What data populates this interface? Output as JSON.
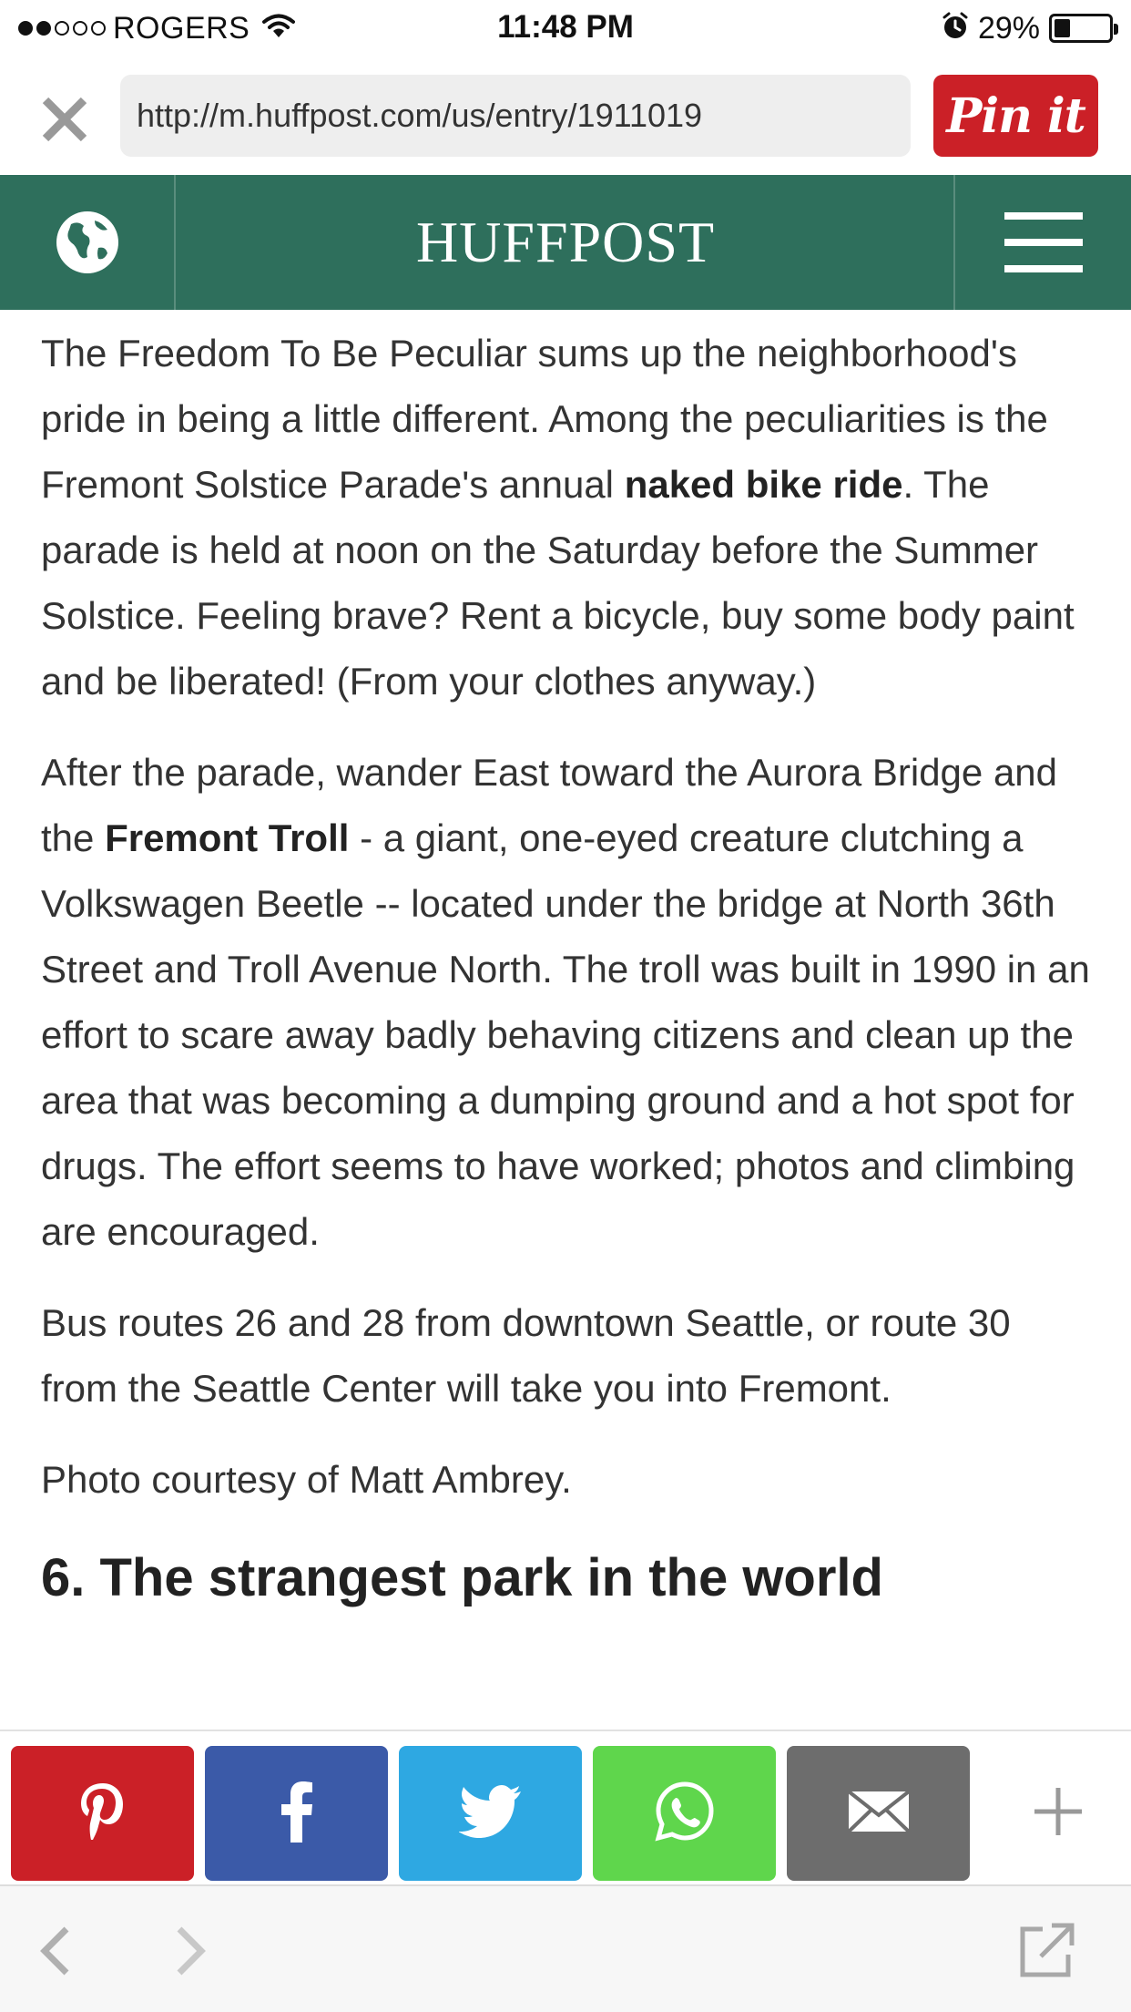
{
  "status_bar": {
    "carrier": "ROGERS",
    "time": "11:48 PM",
    "battery_pct": "29%",
    "signal_bars_filled": 2,
    "signal_bars_total": 5,
    "battery_level": 0.29
  },
  "browser": {
    "url": "http://m.huffpost.com/us/entry/1911019",
    "pin_label": "Pin it"
  },
  "header": {
    "logo": "HUFFPOST"
  },
  "article": {
    "p1_part1": "The Freedom To Be Peculiar sums up the neighborhood's pride in being a little different.  Among the peculiarities is the Fremont Solstice Parade's annual ",
    "p1_bold": "naked bike ride",
    "p1_part2": ". The parade is held at noon on the Saturday before the Summer Solstice.  Feeling brave? Rent a bicycle, buy some body paint and be liberated! (From your clothes anyway.)",
    "p2_part1": "After the parade, wander East toward the Aurora Bridge and the ",
    "p2_bold": "Fremont Troll",
    "p2_part2": " - a giant, one-eyed creature clutching a Volkswagen Beetle -- located under the bridge at North 36th Street and Troll Avenue North. The troll was built in 1990 in an effort to scare away badly behaving citizens and clean up the area that was becoming a dumping ground and a hot spot for drugs. The effort seems to have worked; photos and climbing are encouraged.",
    "p3": "Bus routes 26 and 28 from downtown Seattle, or route 30 from the Seattle Center will take you into Fremont.",
    "p4": "Photo courtesy of Matt Ambrey.",
    "next_heading": "6. The strangest park in the world"
  },
  "share_bar": {
    "buttons": [
      {
        "name": "pinterest",
        "icon": "pinterest-icon",
        "color": "#cb2027"
      },
      {
        "name": "facebook",
        "icon": "facebook-icon",
        "color": "#3b5aa8"
      },
      {
        "name": "twitter",
        "icon": "twitter-icon",
        "color": "#2ea8e2"
      },
      {
        "name": "whatsapp",
        "icon": "whatsapp-icon",
        "color": "#5fd64c"
      },
      {
        "name": "email",
        "icon": "envelope-icon",
        "color": "#6d6d6d"
      }
    ],
    "more_icon": "plus-icon"
  },
  "toolbar": {
    "back_icon": "chevron-left-icon",
    "forward_icon": "chevron-right-icon",
    "external_icon": "external-link-icon"
  },
  "colors": {
    "header_green": "#2e6f5c",
    "pin_red": "#cb2027"
  }
}
